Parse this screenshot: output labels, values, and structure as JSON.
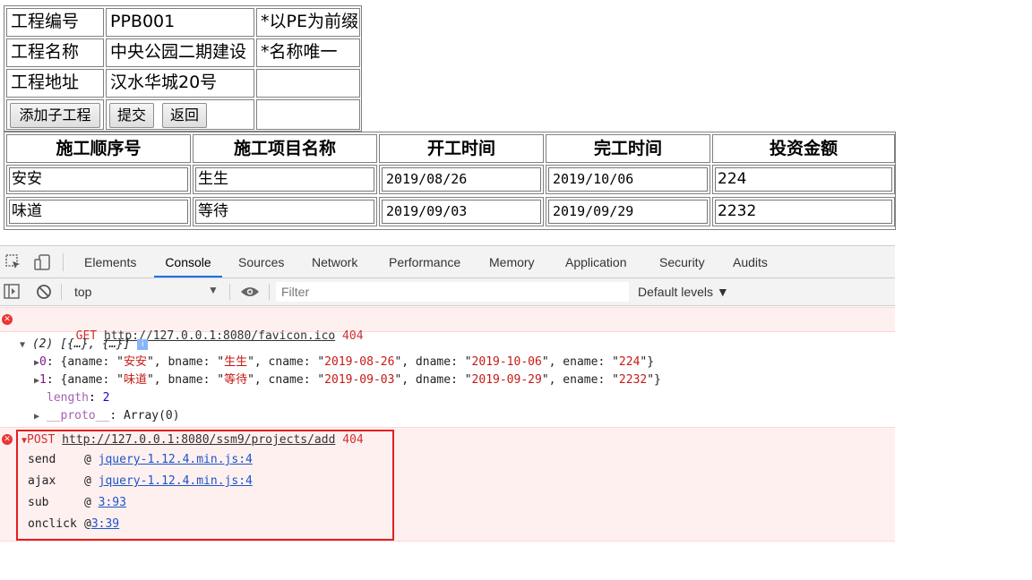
{
  "form": {
    "rows": [
      {
        "label": "工程编号",
        "value": "PPB001",
        "note": "*以PE为前缀"
      },
      {
        "label": "工程名称",
        "value": "中央公园二期建设",
        "note": "*名称唯一"
      },
      {
        "label": "工程地址",
        "value": "汉水华城20号",
        "note": ""
      }
    ],
    "buttons": {
      "add_sub": "添加子工程",
      "submit": "提交",
      "back": "返回"
    }
  },
  "table": {
    "headers": [
      "施工顺序号",
      "施工项目名称",
      "开工时间",
      "完工时间",
      "投资金额"
    ],
    "rows": [
      {
        "order": "安安",
        "name": "生生",
        "start": "2019/08/26",
        "end": "2019/10/06",
        "amount": "224"
      },
      {
        "order": "味道",
        "name": "等待",
        "start": "2019/09/03",
        "end": "2019/09/29",
        "amount": "2232"
      }
    ]
  },
  "devtools": {
    "tabs": [
      "Elements",
      "Console",
      "Sources",
      "Network",
      "Performance",
      "Memory",
      "Application",
      "Security",
      "Audits"
    ],
    "active_tab": "Console",
    "context": "top",
    "filter_placeholder": "Filter",
    "levels": "Default levels ▼",
    "accent": "#1a73e8",
    "error_color": "#d32f2f",
    "console": {
      "get_error": {
        "method": "GET",
        "url": "http://127.0.0.1:8080/favicon.ico",
        "status": "404"
      },
      "array_summary": "(2) [{…}, {…}]",
      "array_items": [
        {
          "index": "0",
          "aname": "安安",
          "bname": "生生",
          "cname": "2019-08-26",
          "dname": "2019-10-06",
          "ename": "224"
        },
        {
          "index": "1",
          "aname": "味道",
          "bname": "等待",
          "cname": "2019-09-03",
          "dname": "2019-09-29",
          "ename": "2232"
        }
      ],
      "length_label": "length",
      "length_value": "2",
      "proto_label": "__proto__",
      "proto_value": "Array(0)",
      "post_error": {
        "method": "POST",
        "url": "http://127.0.0.1:8080/ssm9/projects/add",
        "status": "404"
      },
      "stack": [
        {
          "fn": "send",
          "loc": "jquery-1.12.4.min.js:4"
        },
        {
          "fn": "ajax",
          "loc": "jquery-1.12.4.min.js:4"
        },
        {
          "fn": "sub",
          "loc": "3:93"
        },
        {
          "fn": "onclick",
          "loc": "3:39"
        }
      ]
    }
  }
}
